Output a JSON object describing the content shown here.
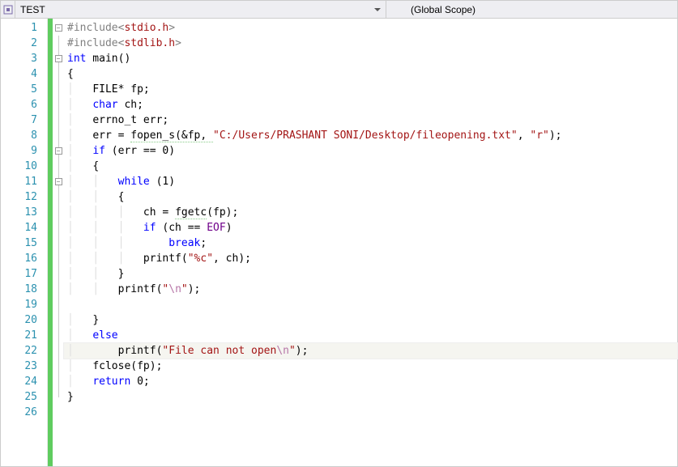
{
  "toolbar": {
    "context_icon": "target-icon",
    "context_label": "TEST",
    "scope_label": "(Global Scope)"
  },
  "gutter": {
    "lines": [
      "1",
      "2",
      "3",
      "4",
      "5",
      "6",
      "7",
      "8",
      "9",
      "10",
      "11",
      "12",
      "13",
      "14",
      "15",
      "16",
      "17",
      "18",
      "19",
      "20",
      "21",
      "22",
      "23",
      "24",
      "25",
      "26"
    ]
  },
  "current_line_index": 21,
  "code": {
    "t": {
      "include": "#include",
      "lt": "<",
      "gt": ">",
      "stdio": "stdio.h",
      "stdlib": "stdlib.h",
      "int": "int",
      "main": " main()",
      "ob": "{",
      "cb": "}",
      "file": "FILE* fp;",
      "char": "char",
      "ch_decl": " ch;",
      "errno": "errno_t err;",
      "err_eq": "err = ",
      "fopen": "fopen_s(&fp, ",
      "path": "\"C:/Users/PRASHANT SONI/Desktop/fileopening.txt\"",
      "comma": ", ",
      "mode": "\"r\"",
      "paren_semi": ");",
      "if": "if",
      "cond": " (err == 0)",
      "while": "while",
      "one": " (1)",
      "ch_assign": "ch = ",
      "fgetc": "fgetc",
      "fgetc_args": "(fp);",
      "if2": "if",
      "cond2": " (ch == ",
      "eof": "EOF",
      "cparen": ")",
      "break": "break",
      "semi": ";",
      "printf": "printf",
      "pc_a": "(",
      "pc_fmt1": "\"%c\"",
      "pc_b": ", ch);",
      "nl_a": "(",
      "nl_s1": "\"",
      "nl_esc": "\\n",
      "nl_s2": "\"",
      "nl_b": ");",
      "else": "else",
      "msg_a": "(",
      "msg1": "\"File can not open",
      "msg2": "\"",
      "msg_b": ");",
      "fclose": "fclose(fp);",
      "return": "return",
      "zero": " 0;"
    }
  }
}
